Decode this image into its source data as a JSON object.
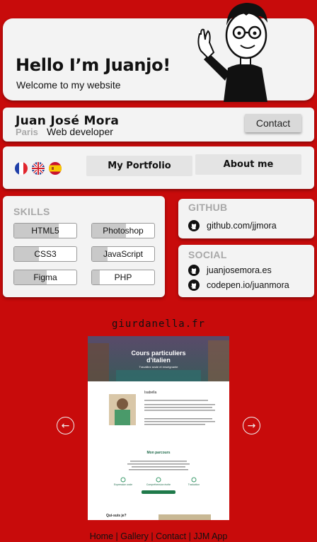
{
  "hero": {
    "title": "Hello I’m Juanjo!",
    "subtitle": "Welcome to my website"
  },
  "profile": {
    "name": "Juan José Mora",
    "city": "Paris",
    "role": "Web developer",
    "contact_label": "Contact"
  },
  "nav": {
    "languages": [
      "french-flag-icon",
      "uk-flag-icon",
      "spain-flag-icon"
    ],
    "portfolio_label": "My Portfolio",
    "about_label": "About me"
  },
  "skills": {
    "title": "SKILLS",
    "items": [
      {
        "label": "HTML5",
        "level": 0.72
      },
      {
        "label": "Photoshop",
        "level": 0.55
      },
      {
        "label": "CSS3",
        "level": 0.4
      },
      {
        "label": "JavaScript",
        "level": 0.25
      },
      {
        "label": "Figma",
        "level": 0.52
      },
      {
        "label": "PHP",
        "level": 0.12
      }
    ]
  },
  "github": {
    "title": "GITHUB",
    "links": [
      "github.com/jjmora"
    ]
  },
  "social": {
    "title": "SOCIAL",
    "links": [
      "juanjosemora.es",
      "codepen.io/juanmora"
    ]
  },
  "gallery": {
    "site": "giurdanella.fr",
    "shot": {
      "hero_title_1": "Cours particuliers",
      "hero_title_2": "d'italien",
      "hero_sub": "Travaillez seule et enseignante",
      "person": "Isabella",
      "section": "Mon parcours",
      "features": [
        "Expression orale",
        "Compréhension écrite",
        "Traduction"
      ],
      "bottom": "Qui-suis je?"
    },
    "prev_icon": "arrow-left-icon",
    "next_icon": "arrow-right-icon"
  },
  "footer": {
    "links": [
      "Home",
      "Gallery",
      "Contact",
      "JJM App"
    ],
    "separator": "|"
  },
  "colors": {
    "background": "#c80b0b",
    "card": "#f3f3f3",
    "button": "#d9d9d9"
  }
}
